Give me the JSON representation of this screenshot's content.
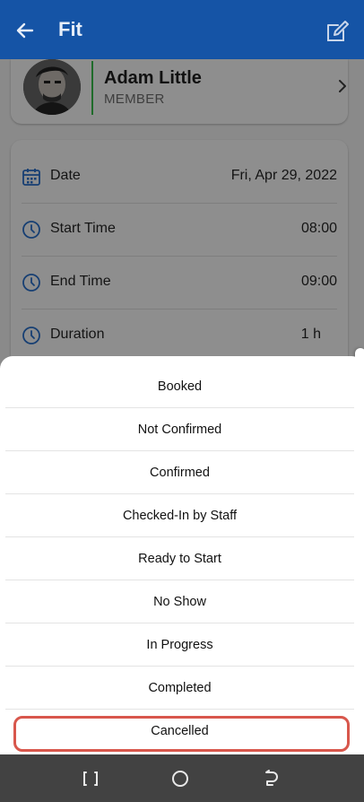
{
  "app_bar": {
    "title": "Fit",
    "back_icon": "arrow-left-icon",
    "edit_icon": "edit-icon",
    "color": "#1554a6"
  },
  "member": {
    "name": "Adam Little",
    "role": "MEMBER"
  },
  "details": [
    {
      "icon": "calendar-icon",
      "label": "Date",
      "value": "Fri, Apr 29, 2022"
    },
    {
      "icon": "clock-icon",
      "label": "Start Time",
      "value": "08:00"
    },
    {
      "icon": "clock-icon",
      "label": "End Time",
      "value": "09:00"
    },
    {
      "icon": "clock-icon",
      "label": "Duration",
      "value": "1 h"
    }
  ],
  "status_options": [
    "Booked",
    "Not Confirmed",
    "Confirmed",
    "Checked-In by Staff",
    "Ready to Start",
    "No Show",
    "In Progress",
    "Completed",
    "Cancelled"
  ],
  "highlight_color": "#d8574c",
  "nav_bar": {
    "buttons": [
      "recent-apps-icon",
      "home-icon",
      "back-icon"
    ]
  }
}
